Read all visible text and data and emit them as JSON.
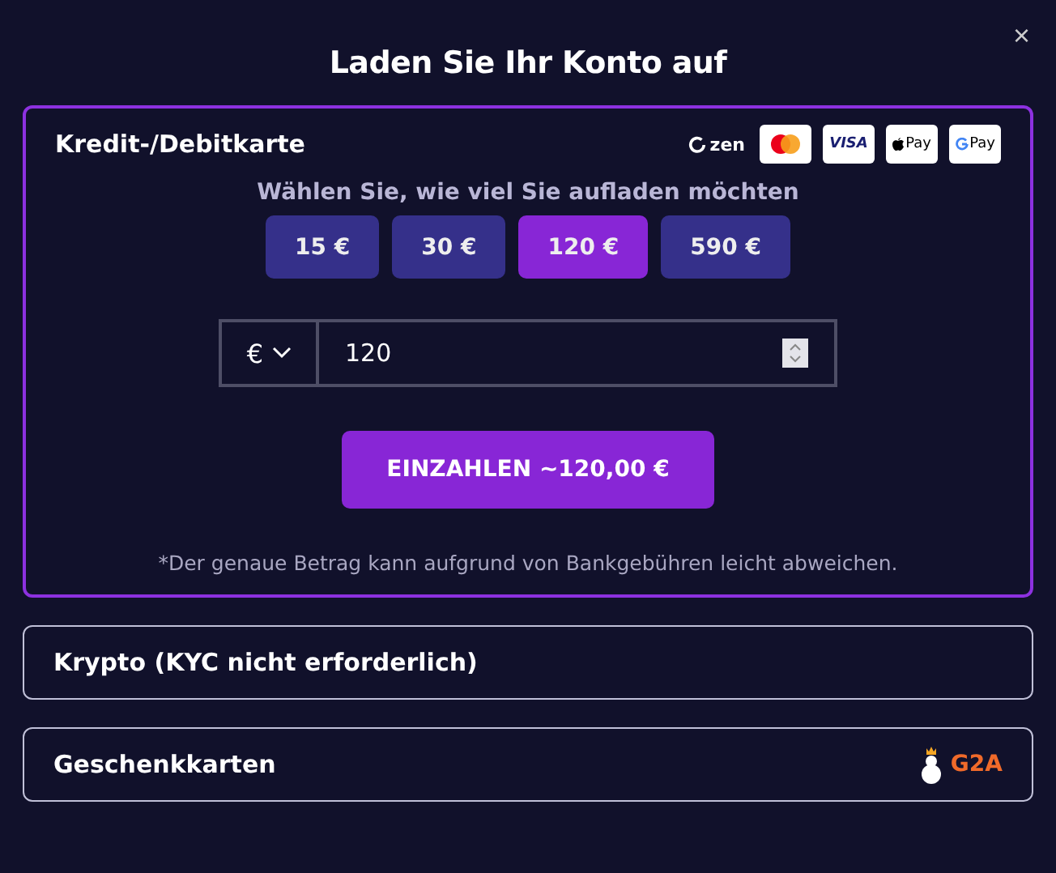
{
  "title": "Laden Sie Ihr Konto auf",
  "close": "×",
  "sections": [
    {
      "label": "Kredit-/Debitkarte",
      "expanded": true,
      "logos": [
        {
          "kind": "zen",
          "text": "zen"
        },
        {
          "kind": "mastercard"
        },
        {
          "kind": "visa",
          "text": "VISA"
        },
        {
          "kind": "applepay",
          "text": "Pay"
        },
        {
          "kind": "googlepay",
          "text": "Pay"
        }
      ],
      "prompt": "Wählen Sie, wie viel Sie aufladen möchten",
      "amounts": [
        {
          "label": "15 €",
          "selected": false
        },
        {
          "label": "30 €",
          "selected": false
        },
        {
          "label": "120 €",
          "selected": true
        },
        {
          "label": "590 €",
          "selected": false
        }
      ],
      "currency": "€",
      "value": "120",
      "button": "EINZAHLEN ~120,00 €",
      "note": "*Der genaue Betrag kann aufgrund von Bankgebühren leicht abweichen."
    },
    {
      "label": "Krypto (KYC nicht erforderlich)",
      "expanded": false
    },
    {
      "label": "Geschenkkarten",
      "expanded": false,
      "brand": "G2A"
    }
  ]
}
